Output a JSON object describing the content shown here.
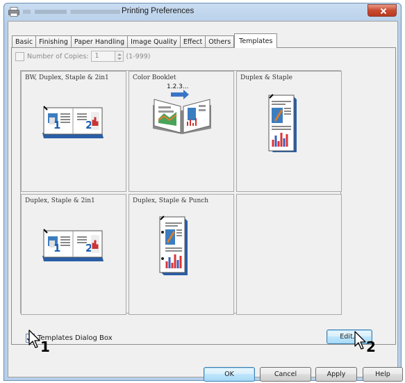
{
  "window": {
    "title": "Printing Preferences",
    "icon": "printer-icon"
  },
  "tabs": [
    {
      "label": "Basic"
    },
    {
      "label": "Finishing"
    },
    {
      "label": "Paper Handling"
    },
    {
      "label": "Image Quality"
    },
    {
      "label": "Effect"
    },
    {
      "label": "Others"
    },
    {
      "label": "Templates",
      "active": true
    }
  ],
  "copies": {
    "label": "Number of Copies:",
    "value": "1",
    "range": "(1-999)",
    "enabled": false
  },
  "templates": [
    {
      "label": "BW, Duplex, Staple & 2in1",
      "thumbnail": "duplex-2in1-landscape-icon"
    },
    {
      "label": "Color Booklet",
      "thumbnail": "booklet-icon",
      "overlay": "1.2.3..."
    },
    {
      "label": "Duplex & Staple",
      "thumbnail": "duplex-staple-portrait-icon"
    },
    {
      "label": "Duplex, Staple & 2in1",
      "thumbnail": "duplex-2in1-landscape-icon"
    },
    {
      "label": "Duplex, Staple & Punch",
      "thumbnail": "duplex-punch-portrait-icon"
    },
    {
      "label": "",
      "thumbnail": ""
    }
  ],
  "dialog_box": {
    "label": "Templates Dialog Box",
    "checked": true
  },
  "buttons": {
    "edit": "Edit...",
    "ok": "OK",
    "cancel": "Cancel",
    "apply": "Apply",
    "help": "Help"
  },
  "callouts": {
    "one": "1",
    "two": "2"
  },
  "colors": {
    "accent": "#3c7fb1",
    "close": "#c84a2f",
    "arrow_blue": "#3a74c6"
  }
}
